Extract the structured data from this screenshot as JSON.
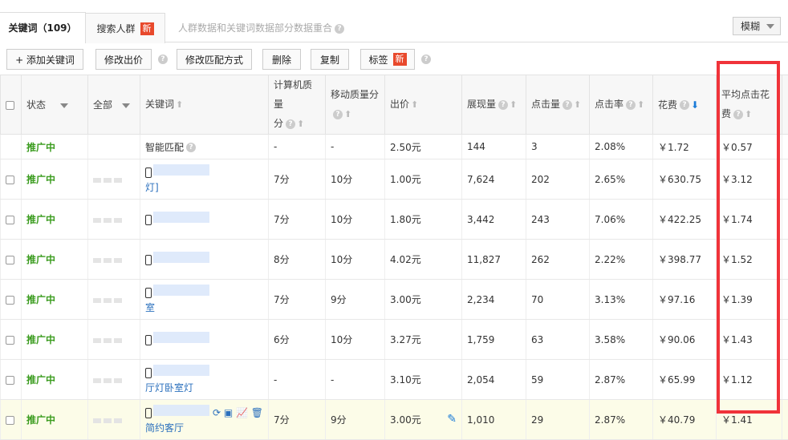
{
  "tabs": {
    "keywords_label": "关键词（109）",
    "crowd_label": "搜索人群",
    "crowd_badge": "新",
    "note": "人群数据和关键词数据部分数据重合"
  },
  "match_select": "模糊",
  "toolbar": {
    "add_keyword": "+ 添加关键词",
    "edit_bid": "修改出价",
    "edit_match": "修改匹配方式",
    "delete": "删除",
    "copy": "复制",
    "tag": "标签",
    "tag_badge": "新"
  },
  "table": {
    "headers": {
      "status": "状态",
      "all": "全部",
      "keyword": "关键词",
      "pc_quality_1": "计算机质量",
      "pc_quality_2": "分",
      "mobile_quality": "移动质量分",
      "bid": "出价",
      "impressions": "展现量",
      "clicks": "点击量",
      "ctr": "点击率",
      "cost": "花费",
      "avg_cpc_1": "平均点击花",
      "avg_cpc_2": "费"
    },
    "smart_row": {
      "status": "推广中",
      "keyword": "智能匹配",
      "pc_quality": "-",
      "mobile_quality": "-",
      "bid": "2.50元",
      "impressions": "144",
      "clicks": "3",
      "ctr": "2.08%",
      "cost": "￥1.72",
      "avg_cpc": "￥0.57"
    },
    "rows": [
      {
        "status": "推广中",
        "kw": "灯]",
        "pc": "7分",
        "mob": "10分",
        "bid": "1.00元",
        "imp": "7,624",
        "clk": "202",
        "ctr": "2.65%",
        "cost": "￥630.75",
        "cpc": "￥3.12"
      },
      {
        "status": "推广中",
        "kw": "",
        "pc": "7分",
        "mob": "10分",
        "bid": "1.80元",
        "imp": "3,442",
        "clk": "243",
        "ctr": "7.06%",
        "cost": "￥422.25",
        "cpc": "￥1.74"
      },
      {
        "status": "推广中",
        "kw": "",
        "pc": "8分",
        "mob": "10分",
        "bid": "4.02元",
        "imp": "11,827",
        "clk": "262",
        "ctr": "2.22%",
        "cost": "￥398.77",
        "cpc": "￥1.52"
      },
      {
        "status": "推广中",
        "kw": "室",
        "pc": "7分",
        "mob": "9分",
        "bid": "3.00元",
        "imp": "2,234",
        "clk": "70",
        "ctr": "3.13%",
        "cost": "￥97.16",
        "cpc": "￥1.39"
      },
      {
        "status": "推广中",
        "kw": "",
        "pc": "6分",
        "mob": "10分",
        "bid": "3.27元",
        "imp": "1,759",
        "clk": "63",
        "ctr": "3.58%",
        "cost": "￥90.06",
        "cpc": "￥1.43"
      },
      {
        "status": "推广中",
        "kw": "厅灯卧室灯",
        "pc": "-",
        "mob": "-",
        "bid": "3.10元",
        "imp": "2,054",
        "clk": "59",
        "ctr": "2.87%",
        "cost": "￥65.99",
        "cpc": "￥1.12"
      },
      {
        "status": "推广中",
        "kw": "简约客厅",
        "pc": "7分",
        "mob": "9分",
        "bid": "3.00元",
        "imp": "1,010",
        "clk": "29",
        "ctr": "2.87%",
        "cost": "￥40.79",
        "cpc": "￥1.41"
      }
    ]
  }
}
